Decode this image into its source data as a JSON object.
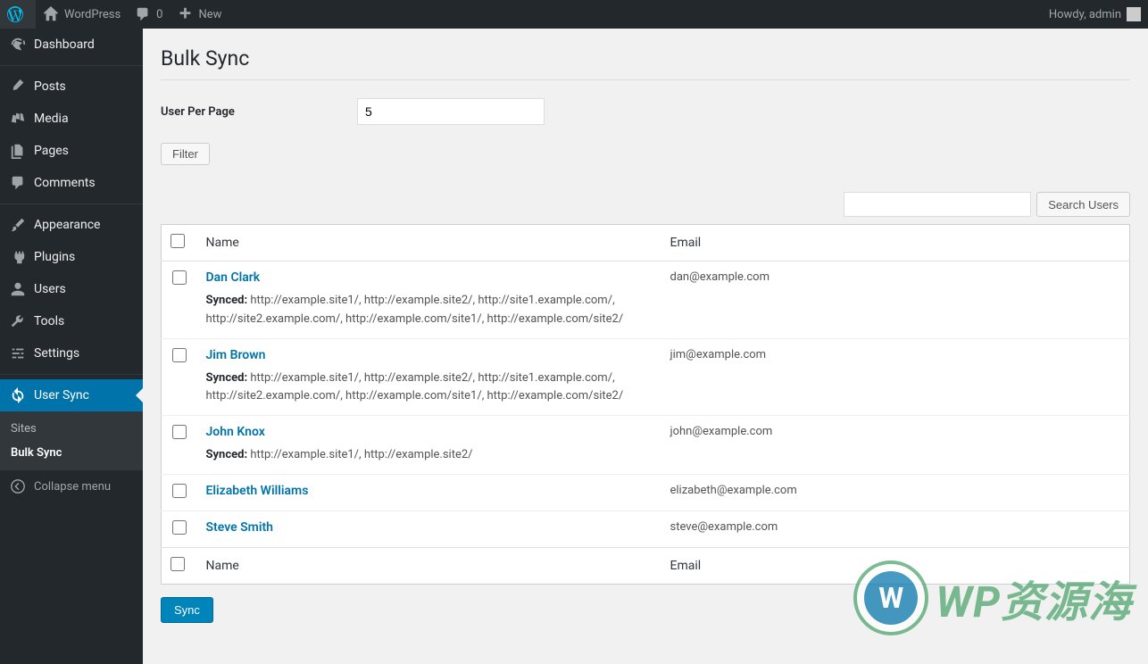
{
  "adminbar": {
    "site_name": "WordPress",
    "comment_count": "0",
    "new_label": "New",
    "howdy": "Howdy, admin"
  },
  "sidebar": {
    "items": [
      {
        "label": "Dashboard",
        "icon": "dashboard"
      },
      {
        "label": "Posts",
        "icon": "pin"
      },
      {
        "label": "Media",
        "icon": "media"
      },
      {
        "label": "Pages",
        "icon": "pages"
      },
      {
        "label": "Comments",
        "icon": "comment"
      },
      {
        "label": "Appearance",
        "icon": "brush"
      },
      {
        "label": "Plugins",
        "icon": "plug"
      },
      {
        "label": "Users",
        "icon": "user"
      },
      {
        "label": "Tools",
        "icon": "wrench"
      },
      {
        "label": "Settings",
        "icon": "sliders"
      },
      {
        "label": "User Sync",
        "icon": "sync"
      }
    ],
    "submenu": [
      {
        "label": "Sites"
      },
      {
        "label": "Bulk Sync"
      }
    ],
    "collapse": "Collapse menu"
  },
  "page": {
    "title": "Bulk Sync",
    "per_page_label": "User Per Page",
    "per_page_value": "5",
    "filter_btn": "Filter",
    "search_btn": "Search Users",
    "sync_btn": "Sync"
  },
  "table": {
    "col_name": "Name",
    "col_email": "Email",
    "synced_label": "Synced:",
    "rows": [
      {
        "name": "Dan Clark",
        "email": "dan@example.com",
        "synced": "http://example.site1/, http://example.site2/, http://site1.example.com/, http://site2.example.com/, http://example.com/site1/, http://example.com/site2/"
      },
      {
        "name": "Jim Brown",
        "email": "jim@example.com",
        "synced": "http://example.site1/, http://example.site2/, http://site1.example.com/, http://site2.example.com/, http://example.com/site1/, http://example.com/site2/"
      },
      {
        "name": "John Knox",
        "email": "john@example.com",
        "synced": "http://example.site1/, http://example.site2/"
      },
      {
        "name": "Elizabeth Williams",
        "email": "elizabeth@example.com",
        "synced": ""
      },
      {
        "name": "Steve Smith",
        "email": "steve@example.com",
        "synced": ""
      }
    ]
  },
  "watermark": {
    "text": "WP资源海"
  }
}
